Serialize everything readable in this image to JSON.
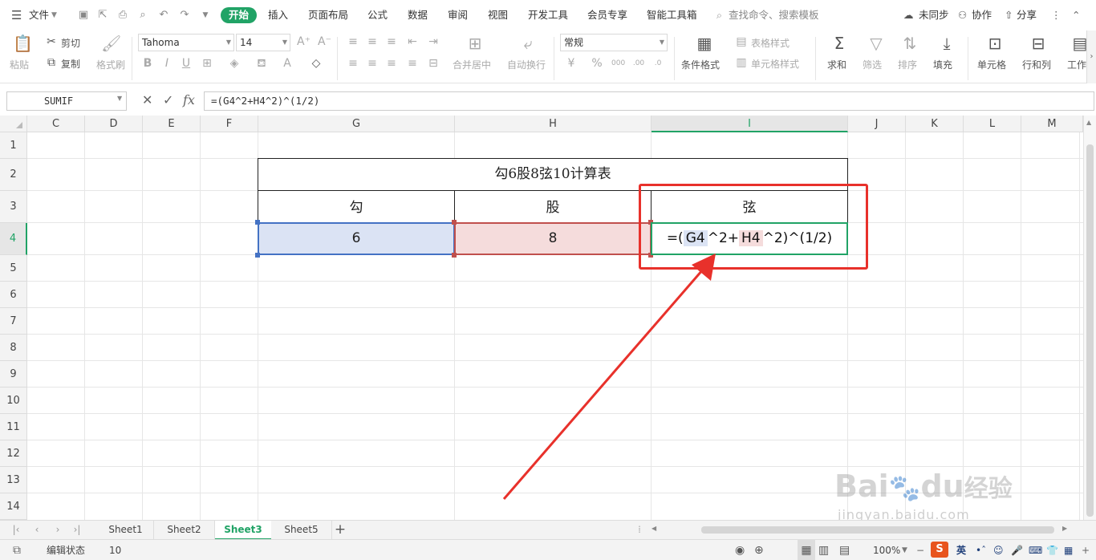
{
  "menubar": {
    "file_label": "文件",
    "tabs": [
      "开始",
      "插入",
      "页面布局",
      "公式",
      "数据",
      "审阅",
      "视图",
      "开发工具",
      "会员专享",
      "智能工具箱"
    ],
    "search_placeholder": "查找命令、搜索模板",
    "sync_label": "未同步",
    "collab_label": "协作",
    "share_label": "分享"
  },
  "ribbon": {
    "paste_label": "粘贴",
    "cut_label": "剪切",
    "copy_label": "复制",
    "format_painter_label": "格式刷",
    "font_name": "Tahoma",
    "font_size": "14",
    "merge_label": "合并居中",
    "wrap_label": "自动换行",
    "number_format": "常规",
    "cond_format_label": "条件格式",
    "table_style_label": "表格样式",
    "cell_style_label": "单元格样式",
    "sum_label": "求和",
    "filter_label": "筛选",
    "sort_label": "排序",
    "fill_label": "填充",
    "cell_label": "单元格",
    "rowcol_label": "行和列",
    "worksheet_label": "工作"
  },
  "formula_bar": {
    "name_box": "SUMIF",
    "fx": "fx",
    "formula": "=(G4^2+H4^2)^(1/2)"
  },
  "grid": {
    "columns": [
      "C",
      "D",
      "E",
      "F",
      "G",
      "H",
      "I",
      "J",
      "K",
      "L",
      "M"
    ],
    "selected_column": "I",
    "rows": [
      "1",
      "2",
      "3",
      "4",
      "5",
      "6",
      "7",
      "8",
      "9",
      "10",
      "11",
      "12",
      "13",
      "14"
    ],
    "selected_row": "4",
    "table_title": "勾6股8弦10计算表",
    "header_gou": "勾",
    "header_gu": "股",
    "header_xian": "弦",
    "value_gou": "6",
    "value_gu": "8",
    "edit_prefix": "=(",
    "edit_ref1": "G4",
    "edit_mid": "^2+",
    "edit_ref2": "H4",
    "edit_suffix": "^2)^(1/2)"
  },
  "sheets": [
    "Sheet1",
    "Sheet2",
    "Sheet3",
    "Sheet5"
  ],
  "active_sheet": "Sheet3",
  "status": {
    "mode": "编辑状态",
    "value": "10",
    "zoom": "100%",
    "ime_lang": "英"
  },
  "colors": {
    "accent": "#21a366",
    "annotation": "#e8312b",
    "ref1_fill": "#dbe3f4",
    "ref1_border": "#4472c4",
    "ref2_fill": "#f5dcdc",
    "ref2_border": "#c0504d"
  },
  "watermark": "Baidu经验 jingyan.baidu.com"
}
